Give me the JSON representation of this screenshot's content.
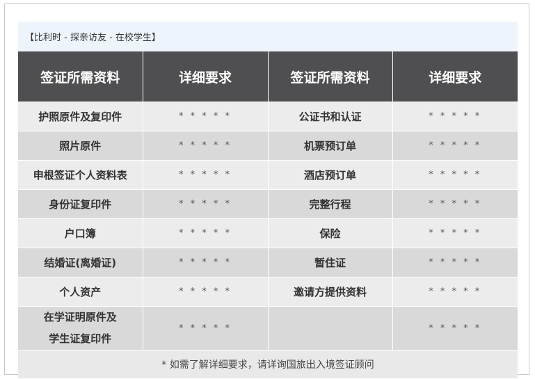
{
  "header": {
    "title": "【比利时  - 探亲访友 - 在校学生】"
  },
  "table": {
    "headers": [
      "签证所需资料",
      "详细要求",
      "签证所需资料",
      "详细要求"
    ],
    "rows": [
      {
        "left_item": "护照原件及复印件",
        "left_req": "* * * * *",
        "right_item": "公证书和认证",
        "right_req": "* * * * *"
      },
      {
        "left_item": "照片原件",
        "left_req": "* * * * *",
        "right_item": "机票预订单",
        "right_req": "* * * * *"
      },
      {
        "left_item": "申根签证个人资料表",
        "left_req": "* * * * *",
        "right_item": "酒店预订单",
        "right_req": "* * * * *"
      },
      {
        "left_item": "身份证复印件",
        "left_req": "* * * * *",
        "right_item": "完整行程",
        "right_req": "* * * * *"
      },
      {
        "left_item": "户口簿",
        "left_req": "* * * * *",
        "right_item": "保险",
        "right_req": "* * * * *"
      },
      {
        "left_item": "结婚证(离婚证)",
        "left_req": "* * * * *",
        "right_item": "暂住证",
        "right_req": "* * * * *"
      },
      {
        "left_item": "个人资产",
        "left_req": "* * * * *",
        "right_item": "邀请方提供资料",
        "right_req": "* * * * *"
      },
      {
        "left_item_line1": "在学证明原件及",
        "left_item_line2": "学生证复印件",
        "left_req": "* * * * *",
        "right_item": "",
        "right_req": "* * * * *"
      }
    ],
    "footer_note": "* 如需了解详细要求，请详询国旅出入境签证顾问"
  }
}
